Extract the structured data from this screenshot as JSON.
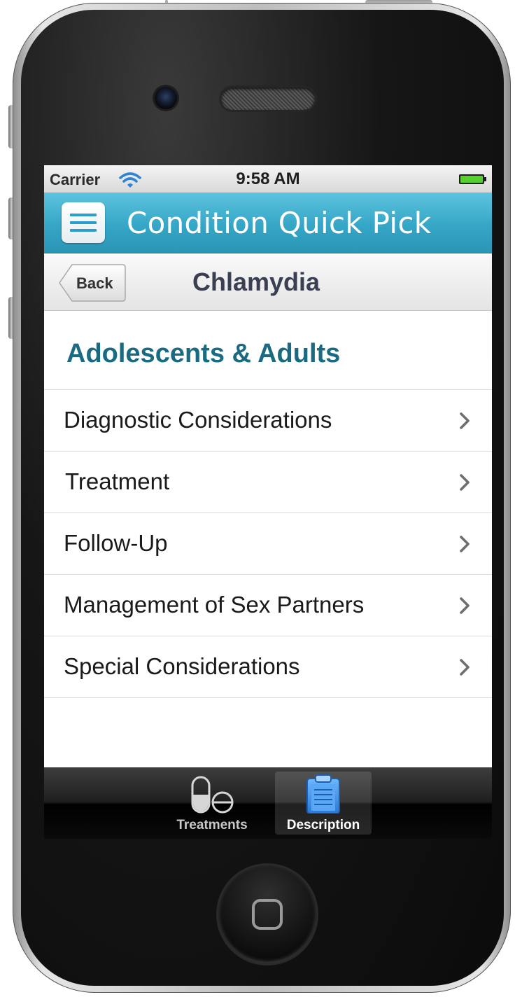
{
  "status_bar": {
    "carrier": "Carrier",
    "time": "9:58 AM"
  },
  "header": {
    "title": "Condition Quick Pick",
    "accent_color": "#3aa9c9"
  },
  "nav": {
    "back_label": "Back",
    "title": "Chlamydia"
  },
  "section": {
    "title": "Adolescents & Adults"
  },
  "list": {
    "items": [
      {
        "label": "Diagnostic Considerations"
      },
      {
        "label": "Treatment"
      },
      {
        "label": "Follow-Up"
      },
      {
        "label": "Management of Sex Partners"
      },
      {
        "label": "Special Considerations"
      }
    ]
  },
  "tabs": [
    {
      "label": "Treatments",
      "icon": "pill-icon",
      "selected": false
    },
    {
      "label": "Description",
      "icon": "clipboard-icon",
      "selected": true
    }
  ],
  "colors": {
    "section_title": "#1a6a82",
    "nav_title": "#3a3f52",
    "tab_selected_icon": "#3b8fe0"
  }
}
